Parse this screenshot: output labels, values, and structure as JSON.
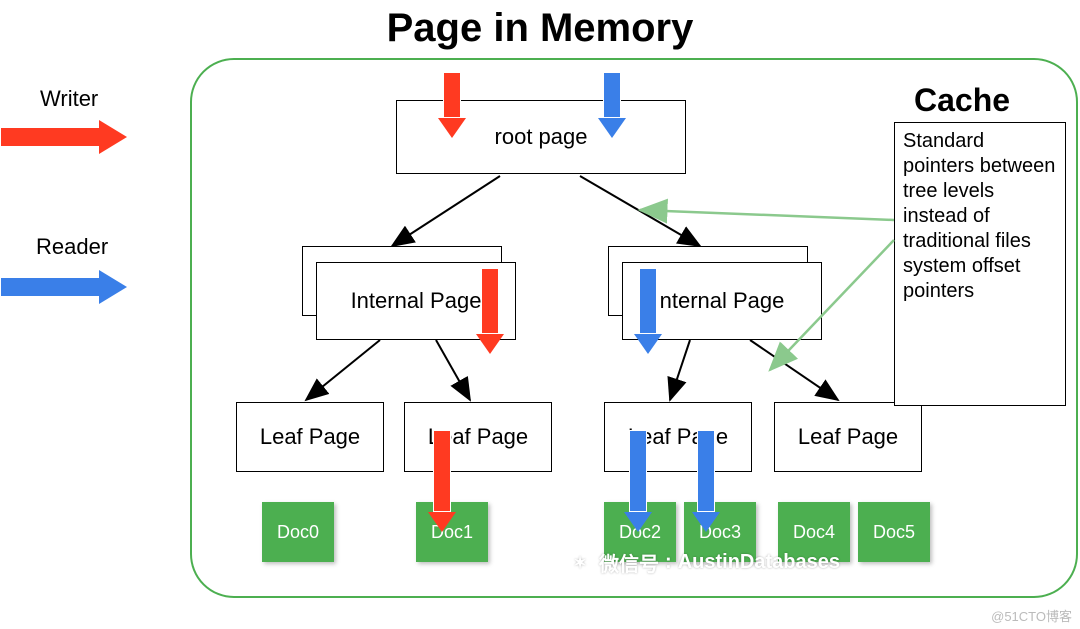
{
  "title": "Page in Memory",
  "legend": {
    "writer": "Writer",
    "reader": "Reader"
  },
  "root": "root page",
  "internal": {
    "left": "Internal Page",
    "right": "nternal Page"
  },
  "leaf": "Leaf Page",
  "docs": [
    "Doc0",
    "Doc1",
    "Doc2",
    "Doc3",
    "Doc4",
    "Doc5"
  ],
  "cache": {
    "title": "Cache",
    "text": "Standard pointers between tree levels instead of traditional files system offset pointers"
  },
  "watermark": {
    "label": "微信号",
    "value": "AustinDatabases"
  },
  "credit": "@51CTO博客",
  "colors": {
    "writer": "#ff3a21",
    "reader": "#3a7fe8",
    "panel": "#4caf50",
    "doc": "#4caf50"
  }
}
